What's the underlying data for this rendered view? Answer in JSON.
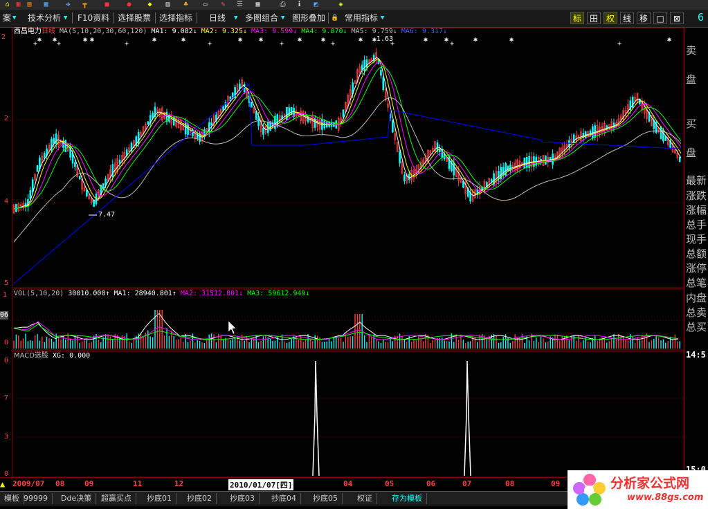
{
  "toolbar": {
    "buttons": [
      {
        "label": "案"
      },
      {
        "label": "技术分析"
      },
      {
        "label": "F10资料"
      },
      {
        "label": "选择股票"
      },
      {
        "label": "选择指标"
      },
      {
        "label": "日线"
      },
      {
        "label": "多图组合"
      },
      {
        "label": "图形叠加"
      },
      {
        "label": "常用指标"
      }
    ],
    "right_buttons": [
      "标",
      "田",
      "权",
      "线",
      "移",
      "□",
      "⊠"
    ],
    "right_digit": "6"
  },
  "price_panel": {
    "stock_name": "西昌电力",
    "period": "日线",
    "ma_label": "MA(5,10,20,30,60,120)",
    "ma1": "MA1: 9.082↓",
    "ma2": "MA2: 9.325↓",
    "ma3": "MA3: 9.599↓",
    "ma4": "MA4: 9.870↓",
    "ma5": "MA5: 9.759↓",
    "ma6": "MA6: 9.317↓",
    "low_label": "7.47",
    "high_label": "1.63",
    "axis_labels": [
      "2",
      "2",
      "4",
      "5"
    ]
  },
  "vol_panel": {
    "label": "VOL(5,10,20)",
    "value": "30010.000↑",
    "ma1": "MA1: 28940.801↑",
    "ma2": "MA2: 31512.801↓",
    "ma3": "MA3: 59612.949↓",
    "axis_labels": [
      "1",
      "06",
      "0"
    ]
  },
  "macd_panel": {
    "label": "MACD选股",
    "xg": "XG: 0.000",
    "axis_labels": [
      "0",
      "7",
      "3",
      "0"
    ]
  },
  "right_panel": {
    "labels": [
      "卖",
      "盘",
      "买",
      "盘",
      "最新",
      "涨跌",
      "涨幅",
      "总手",
      "现手",
      "总额",
      "涨停",
      "总笔",
      "内盘",
      "总卖",
      "总买"
    ],
    "time1": "14:5",
    "time2": "15:0"
  },
  "time_axis": {
    "ticks": [
      "2009/07",
      "08",
      "09",
      "11",
      "12",
      "2010/01/07[四]",
      "04",
      "05",
      "06",
      "07",
      "08",
      "09"
    ]
  },
  "tabs": [
    "模板",
    "99999",
    "Dde决策",
    "超赢买点",
    "抄底01",
    "抄底02",
    "抄底03",
    "抄底04",
    "抄底05",
    "权证",
    "存为模板"
  ],
  "logo": {
    "title": "分析家公式网",
    "url": "www.88gs.com"
  },
  "colors": {
    "ma1": "#ffffff",
    "ma2": "#ffff00",
    "ma3": "#ff00ff",
    "ma4": "#00ff00",
    "ma5": "#c0c0c0",
    "ma6": "#0000ff",
    "up": "#ff4040",
    "down": "#00ffff",
    "grid": "#800000"
  }
}
